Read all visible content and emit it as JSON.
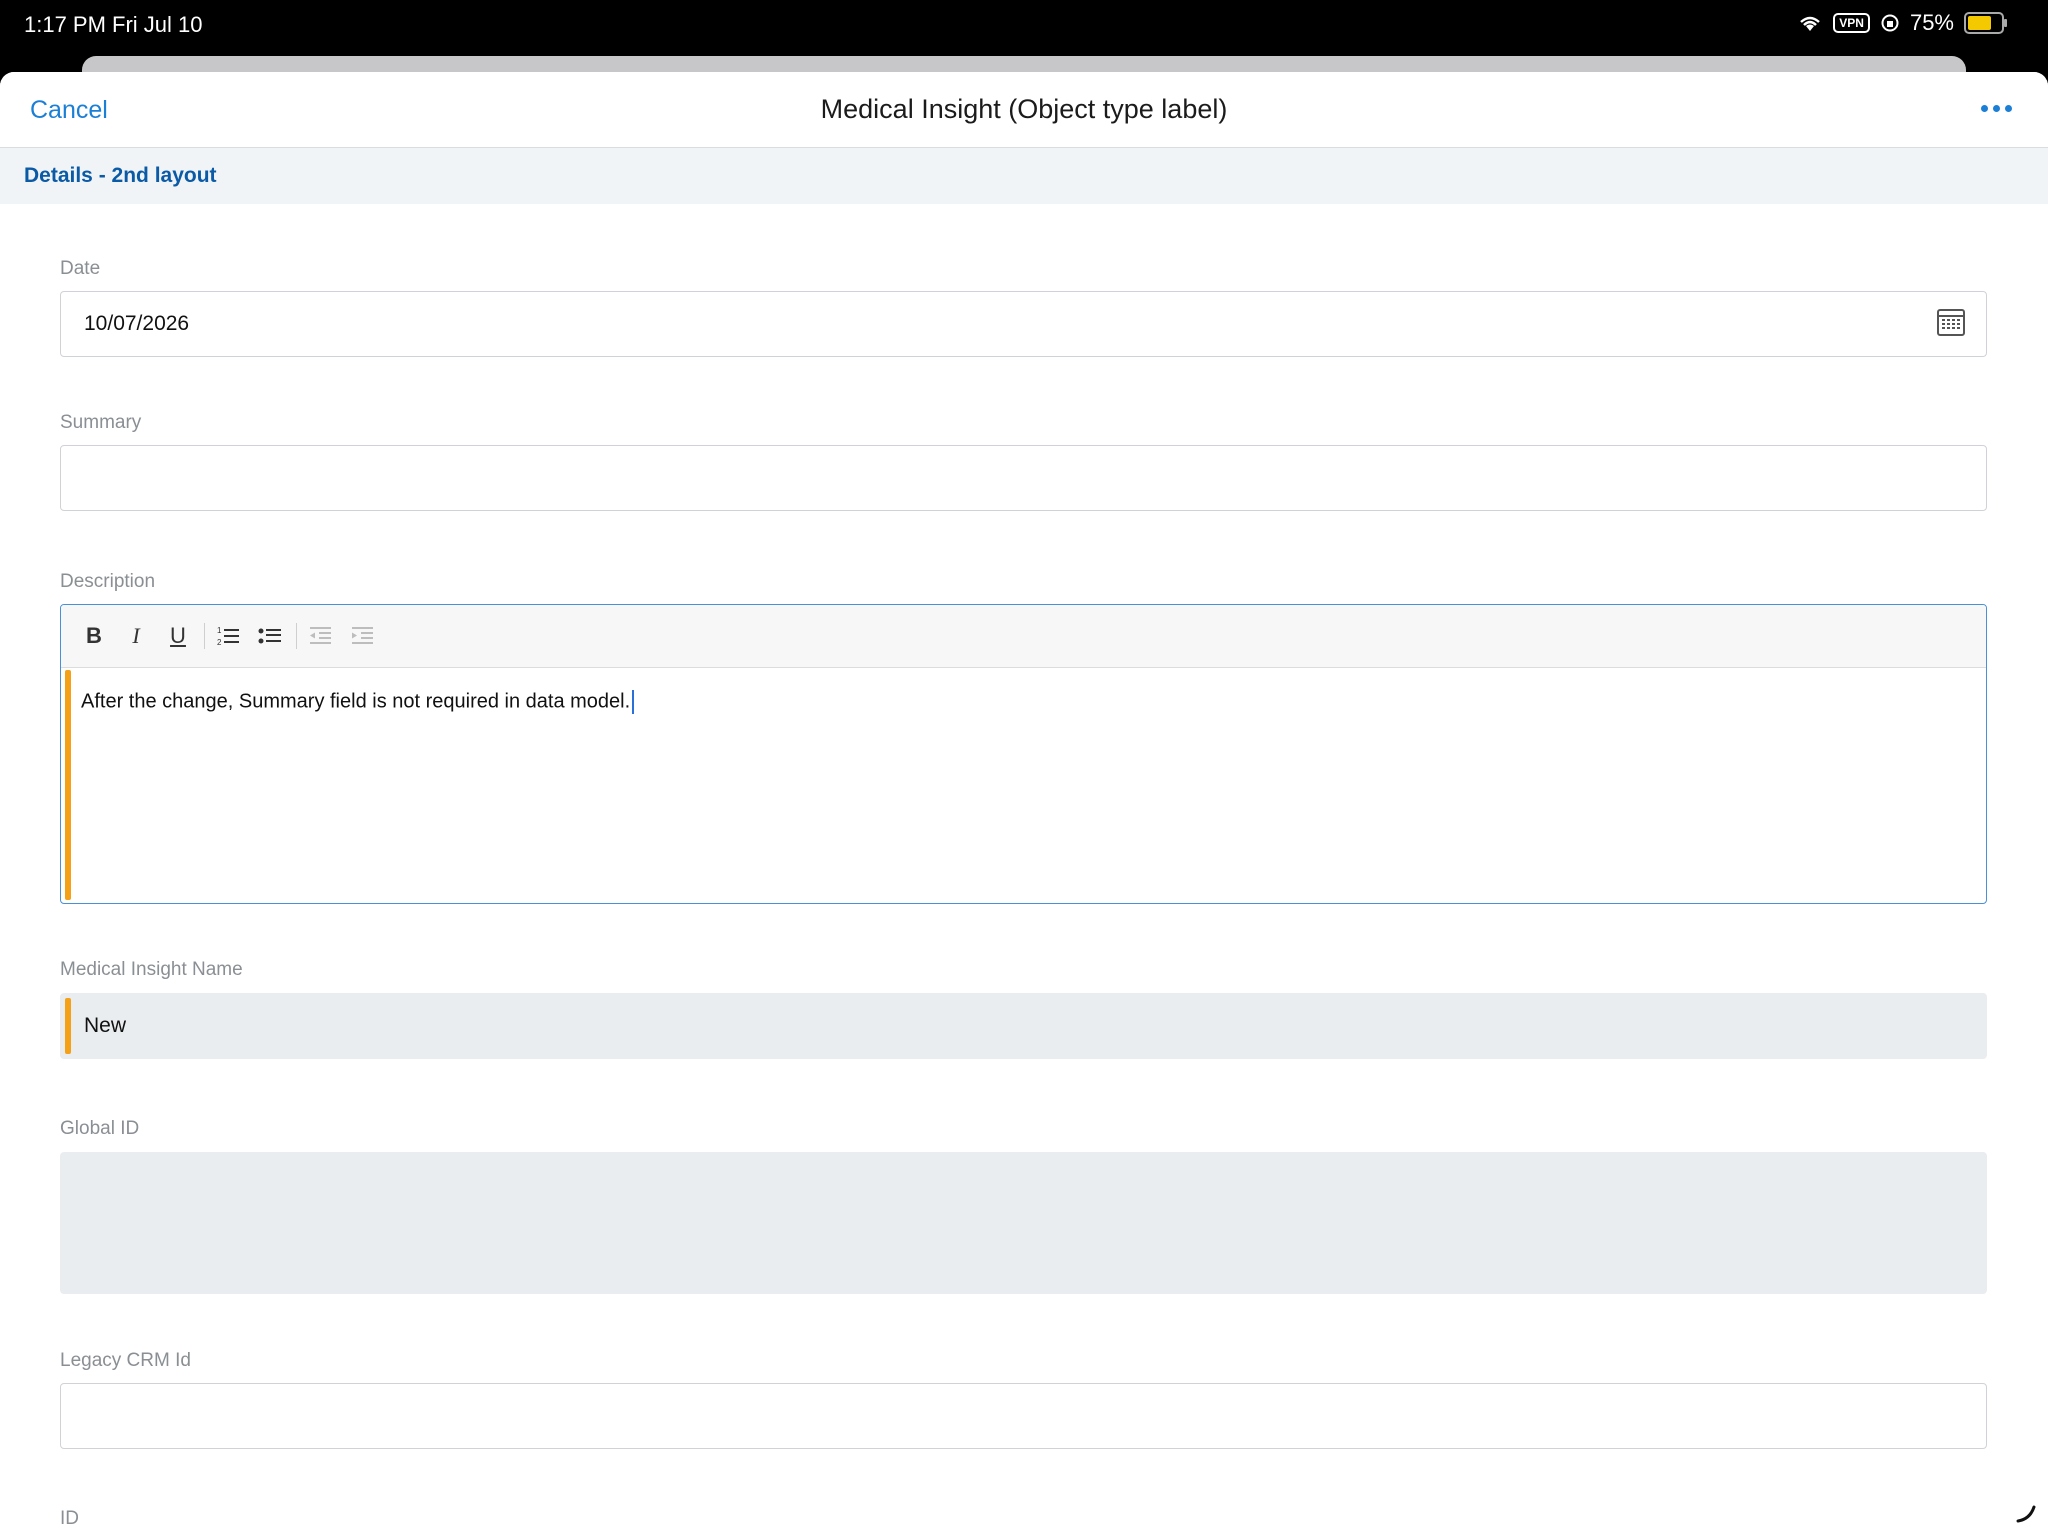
{
  "status_bar": {
    "time": "1:17 PM",
    "date": "Fri Jul 10",
    "vpn": "VPN",
    "battery": "75%",
    "battery_level": 0.75,
    "icons": [
      "wifi-icon",
      "vpn-icon",
      "rotation-lock-icon",
      "battery-icon"
    ]
  },
  "nav": {
    "cancel_label": "Cancel",
    "title": "Medical Insight (Object type label)",
    "more_icon": "more-icon"
  },
  "section": {
    "title": "Details - 2nd layout"
  },
  "fields": {
    "date": {
      "label": "Date",
      "value": "10/07/2026",
      "icon": "calendar-icon"
    },
    "summary": {
      "label": "Summary",
      "value": ""
    },
    "description": {
      "label": "Description",
      "value": "After the change, Summary field is not required in data model.",
      "toolbar": {
        "bold": "B",
        "italic": "I",
        "underline": "U",
        "icons": [
          "numbered-list-icon",
          "bulleted-list-icon",
          "outdent-icon",
          "indent-icon"
        ]
      }
    },
    "name": {
      "label": "Medical Insight Name",
      "value": "New"
    },
    "global_id": {
      "label": "Global ID",
      "value": ""
    },
    "legacy_crm_id": {
      "label": "Legacy CRM Id",
      "value": ""
    },
    "id": {
      "label": "ID"
    }
  },
  "colors": {
    "accent": "#1b7fd6",
    "section_title": "#0b5aa6",
    "required_bar": "#f4a118",
    "focus_border": "#4a90d9"
  }
}
